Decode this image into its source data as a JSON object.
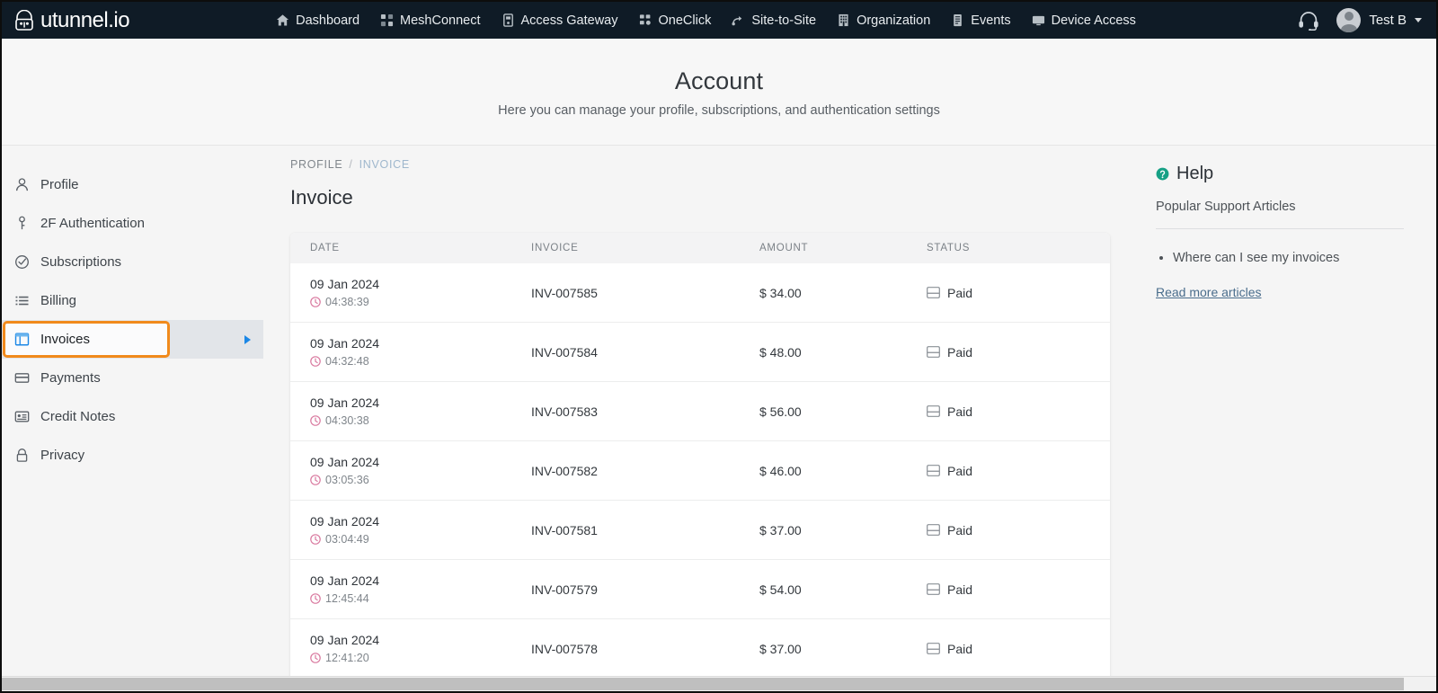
{
  "topnav": {
    "brand": "utunnel.io",
    "brand_icon": "utunnel-lock-logo",
    "items": [
      {
        "label": "Dashboard",
        "icon": "home-icon"
      },
      {
        "label": "MeshConnect",
        "icon": "mesh-icon"
      },
      {
        "label": "Access Gateway",
        "icon": "gateway-icon"
      },
      {
        "label": "OneClick",
        "icon": "oneclick-icon"
      },
      {
        "label": "Site-to-Site",
        "icon": "site-to-site-icon"
      },
      {
        "label": "Organization",
        "icon": "building-icon"
      },
      {
        "label": "Events",
        "icon": "events-icon"
      },
      {
        "label": "Device Access",
        "icon": "monitor-icon"
      }
    ],
    "support_icon": "headset-icon",
    "user_name": "Test B",
    "user_caret_icon": "chevron-down-icon",
    "avatar_icon": "user-avatar"
  },
  "page": {
    "title": "Account",
    "subtitle": "Here you can manage your profile, subscriptions, and authentication settings"
  },
  "sidebar": {
    "items": [
      {
        "label": "Profile",
        "icon": "person-icon",
        "active": false
      },
      {
        "label": "2F Authentication",
        "icon": "key-icon",
        "active": false
      },
      {
        "label": "Subscriptions",
        "icon": "check-circle-icon",
        "active": false
      },
      {
        "label": "Billing",
        "icon": "list-icon",
        "active": false
      },
      {
        "label": "Invoices",
        "icon": "table-icon",
        "active": true
      },
      {
        "label": "Payments",
        "icon": "card-icon",
        "active": false
      },
      {
        "label": "Credit Notes",
        "icon": "note-icon",
        "active": false
      },
      {
        "label": "Privacy",
        "icon": "lock-icon",
        "active": false
      }
    ],
    "active_arrow_icon": "arrow-right-icon",
    "highlight_color": "#f18a1c",
    "accent_color": "#1b87e6"
  },
  "breadcrumb": {
    "parent": "PROFILE",
    "separator": "/",
    "current": "INVOICE"
  },
  "main": {
    "heading": "Invoice",
    "columns": [
      "DATE",
      "INVOICE",
      "AMOUNT",
      "STATUS"
    ],
    "rows": [
      {
        "date": "09 Jan 2024",
        "time": "04:38:39",
        "invoice": "INV-007585",
        "amount": "$ 34.00",
        "status": "Paid"
      },
      {
        "date": "09 Jan 2024",
        "time": "04:32:48",
        "invoice": "INV-007584",
        "amount": "$ 48.00",
        "status": "Paid"
      },
      {
        "date": "09 Jan 2024",
        "time": "04:30:38",
        "invoice": "INV-007583",
        "amount": "$ 56.00",
        "status": "Paid"
      },
      {
        "date": "09 Jan 2024",
        "time": "03:05:36",
        "invoice": "INV-007582",
        "amount": "$ 46.00",
        "status": "Paid"
      },
      {
        "date": "09 Jan 2024",
        "time": "03:04:49",
        "invoice": "INV-007581",
        "amount": "$ 37.00",
        "status": "Paid"
      },
      {
        "date": "09 Jan 2024",
        "time": "12:45:44",
        "invoice": "INV-007579",
        "amount": "$ 54.00",
        "status": "Paid"
      },
      {
        "date": "09 Jan 2024",
        "time": "12:41:20",
        "invoice": "INV-007578",
        "amount": "$ 37.00",
        "status": "Paid"
      }
    ],
    "clock_icon": "clock-icon",
    "status_icon": "card-icon",
    "clock_color": "#d9799f"
  },
  "help": {
    "title": "Help",
    "title_icon": "question-circle-icon",
    "icon_color": "#16a085",
    "subtitle": "Popular Support Articles",
    "articles": [
      "Where can I see my invoices"
    ],
    "read_more": "Read more articles"
  }
}
